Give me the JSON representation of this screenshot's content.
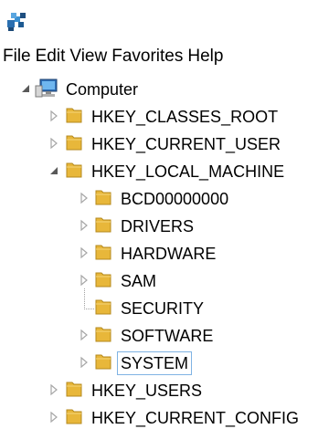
{
  "menu": [
    "File",
    "Edit",
    "View",
    "Favorites",
    "Help"
  ],
  "tree": {
    "root": "Computer",
    "hives": [
      {
        "label": "HKEY_CLASSES_ROOT",
        "state": "collapsed"
      },
      {
        "label": "HKEY_CURRENT_USER",
        "state": "collapsed"
      },
      {
        "label": "HKEY_LOCAL_MACHINE",
        "state": "expanded"
      },
      {
        "label": "HKEY_USERS",
        "state": "collapsed"
      },
      {
        "label": "HKEY_CURRENT_CONFIG",
        "state": "collapsed"
      }
    ],
    "hklm_children": [
      {
        "label": "BCD00000000",
        "state": "collapsed"
      },
      {
        "label": "DRIVERS",
        "state": "collapsed"
      },
      {
        "label": "HARDWARE",
        "state": "collapsed"
      },
      {
        "label": "SAM",
        "state": "collapsed"
      },
      {
        "label": "SECURITY",
        "state": "leaf"
      },
      {
        "label": "SOFTWARE",
        "state": "collapsed"
      },
      {
        "label": "SYSTEM",
        "state": "collapsed",
        "selected": true
      }
    ]
  },
  "icons": {
    "app": "regedit-icon",
    "computer": "computer-icon",
    "folder": "folder-icon",
    "collapsed": "triangle-right-icon",
    "expanded": "triangle-down-icon"
  },
  "colors": {
    "folder": "#e8b73a",
    "selection_border": "#7fb3e3",
    "expander": "#a6a6a6"
  }
}
